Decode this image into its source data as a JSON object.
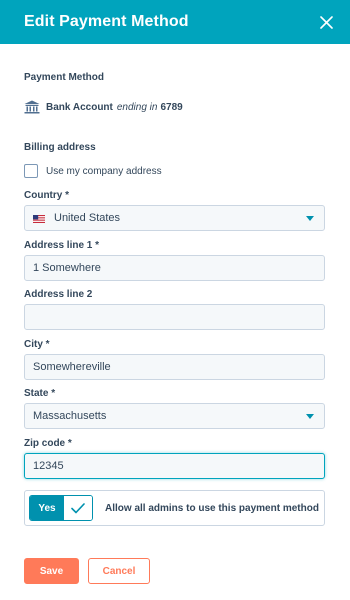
{
  "header": {
    "title": "Edit Payment Method",
    "close_icon": "close-icon"
  },
  "payment_method": {
    "label": "Payment Method",
    "icon": "bank-icon",
    "bank_name": "Bank Account",
    "ending_text": "ending in",
    "ending_digits": "6789"
  },
  "billing": {
    "label": "Billing address",
    "use_company_address_label": "Use my company address",
    "use_company_address_checked": false
  },
  "fields": {
    "country": {
      "label": "Country *",
      "value": "United States",
      "flag_icon": "us-flag-icon"
    },
    "address1": {
      "label": "Address line 1 *",
      "value": "1 Somewhere"
    },
    "address2": {
      "label": "Address line 2",
      "value": ""
    },
    "city": {
      "label": "City *",
      "value": "Somewhereville"
    },
    "state": {
      "label": "State *",
      "value": "Massachusetts"
    },
    "zip": {
      "label": "Zip code *",
      "value": "12345"
    }
  },
  "admin_toggle": {
    "state_label": "Yes",
    "enabled": true,
    "text": "Allow all admins to use this payment method"
  },
  "actions": {
    "save_label": "Save",
    "cancel_label": "Cancel"
  },
  "colors": {
    "header_bg": "#00a4bd",
    "accent": "#0091ae",
    "primary_button": "#ff7a59",
    "text": "#33475b"
  }
}
